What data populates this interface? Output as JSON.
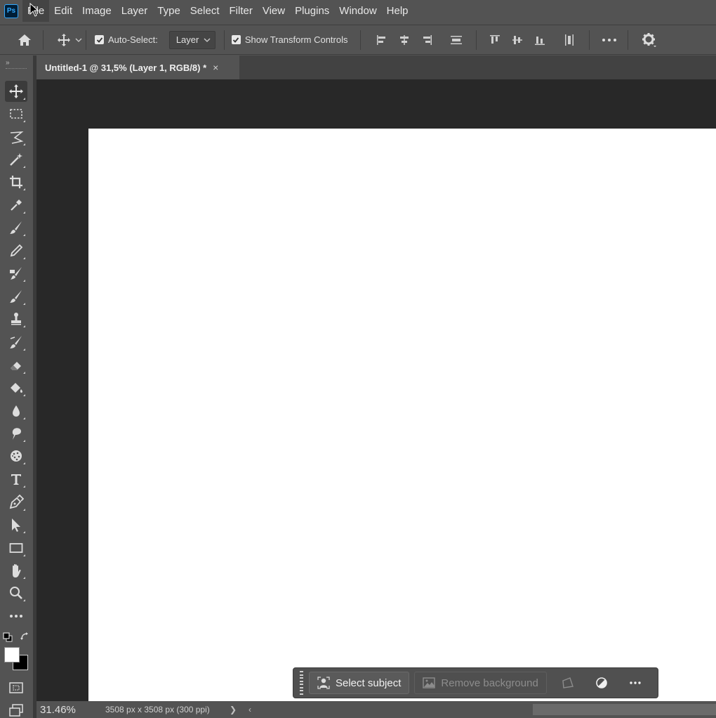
{
  "app": {
    "logo_text": "Ps"
  },
  "menu": {
    "items": [
      "File",
      "Edit",
      "Image",
      "Layer",
      "Type",
      "Select",
      "Filter",
      "View",
      "Plugins",
      "Window",
      "Help"
    ]
  },
  "options": {
    "auto_select_label": "Auto-Select:",
    "auto_select_checked": true,
    "auto_select_target": "Layer",
    "show_transform_label": "Show Transform Controls",
    "show_transform_checked": true
  },
  "document": {
    "tab_title": "Untitled-1 @ 31,5% (Layer 1, RGB/8) *",
    "close_glyph": "×"
  },
  "toolbar": {
    "expand_glyph": "»",
    "tools": [
      "move-tool-icon",
      "rectangular-marquee-icon",
      "lasso-icon",
      "magic-wand-icon",
      "crop-icon",
      "eyedropper-icon",
      "brush-icon",
      "pencil-icon",
      "mixer-brush-icon",
      "history-brush-icon",
      "clone-stamp-icon",
      "art-history-brush-icon",
      "eraser-icon",
      "paint-bucket-icon",
      "blur-icon",
      "smudge-icon",
      "sponge-icon",
      "type-icon",
      "pen-icon",
      "path-selection-icon",
      "rectangle-icon",
      "hand-icon",
      "zoom-icon",
      "more-tools-icon"
    ],
    "foreground_color": "#ffffff",
    "background_color": "#000000"
  },
  "contextual_bar": {
    "select_subject_label": "Select subject",
    "remove_background_label": "Remove background"
  },
  "status": {
    "zoom": "31.46%",
    "doc_info": "3508 px x 3508 px (300 ppi)",
    "more_glyph": "❯",
    "scroll_left_glyph": "‹"
  },
  "colors": {
    "chrome": "#535353",
    "pasteboard": "#282828",
    "canvas": "#ffffff",
    "accent": "#31a8ff"
  }
}
